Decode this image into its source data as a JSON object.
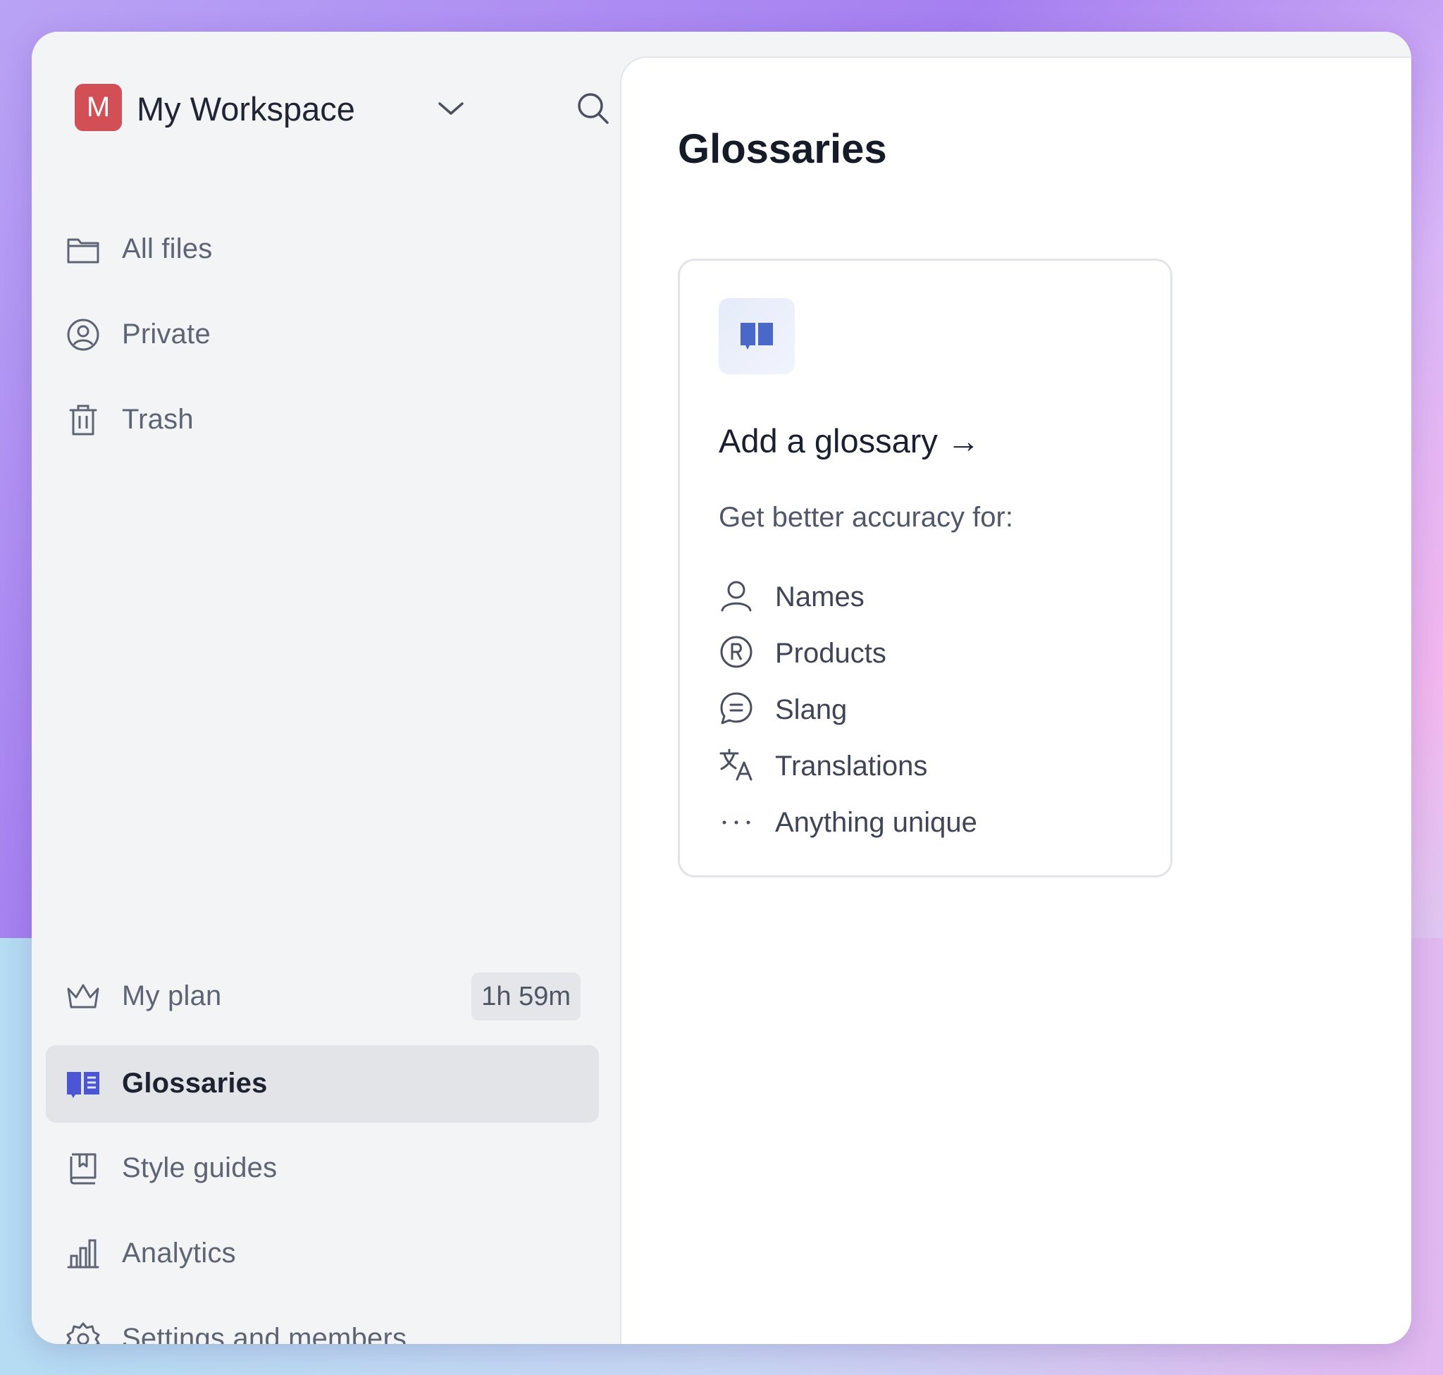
{
  "workspace": {
    "initial": "M",
    "name": "My Workspace"
  },
  "sidebar": {
    "top_items": [
      {
        "label": "All files",
        "icon": "folder-icon"
      },
      {
        "label": "Private",
        "icon": "user-circle-icon"
      },
      {
        "label": "Trash",
        "icon": "trash-icon"
      }
    ],
    "bottom_items": [
      {
        "label": "My plan",
        "icon": "crown-icon",
        "badge": "1h 59m"
      },
      {
        "label": "Glossaries",
        "icon": "glossary-book-icon",
        "active": true
      },
      {
        "label": "Style guides",
        "icon": "bookmark-book-icon"
      },
      {
        "label": "Analytics",
        "icon": "bar-chart-icon"
      },
      {
        "label": "Settings and members",
        "icon": "gear-icon"
      }
    ]
  },
  "main": {
    "title": "Glossaries",
    "card": {
      "title": "Add a glossary →",
      "subtitle": "Get better accuracy for:",
      "features": [
        {
          "label": "Names",
          "icon": "person-icon"
        },
        {
          "label": "Products",
          "icon": "registered-icon"
        },
        {
          "label": "Slang",
          "icon": "chat-bubble-icon"
        },
        {
          "label": "Translations",
          "icon": "translate-icon"
        },
        {
          "label": "Anything unique",
          "icon": "ellipsis-icon"
        }
      ]
    }
  },
  "colors": {
    "badge": "#d14f55",
    "accent": "#4a56d6",
    "active_bg": "#e3e4e7"
  }
}
